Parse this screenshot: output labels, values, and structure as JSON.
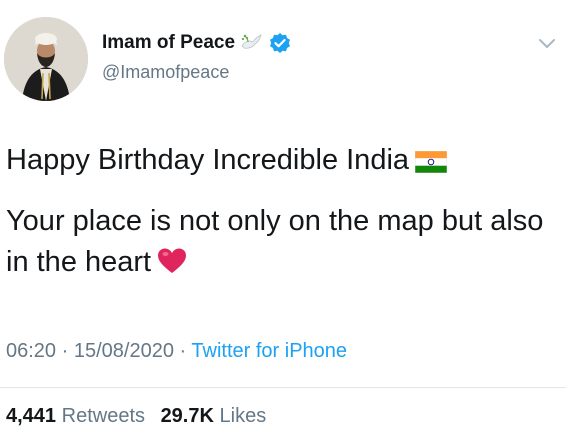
{
  "account": {
    "display_name": "Imam of Peace",
    "handle": "@Imamofpeace"
  },
  "tweet": {
    "line1": "Happy Birthday Incredible India",
    "line2": "Your place is not only on the map but also in the heart"
  },
  "meta": {
    "time": "06:20",
    "separator": "·",
    "date": "15/08/2020",
    "source": "Twitter for iPhone"
  },
  "stats": {
    "retweets_count": "4,441",
    "retweets_label": "Retweets",
    "likes_count": "29.7K",
    "likes_label": "Likes"
  },
  "icons": {
    "avatar": "profile-photo",
    "name_badge_1": "dove-icon",
    "name_badge_2": "verified-badge-icon",
    "menu": "chevron-down-icon",
    "flag": "india-flag-emoji",
    "heart": "red-heart-emoji"
  },
  "colors": {
    "text": "#14171a",
    "secondary": "#657786",
    "link": "#1da1f2",
    "verified": "#1da1f2",
    "heart": "#e0245e"
  }
}
